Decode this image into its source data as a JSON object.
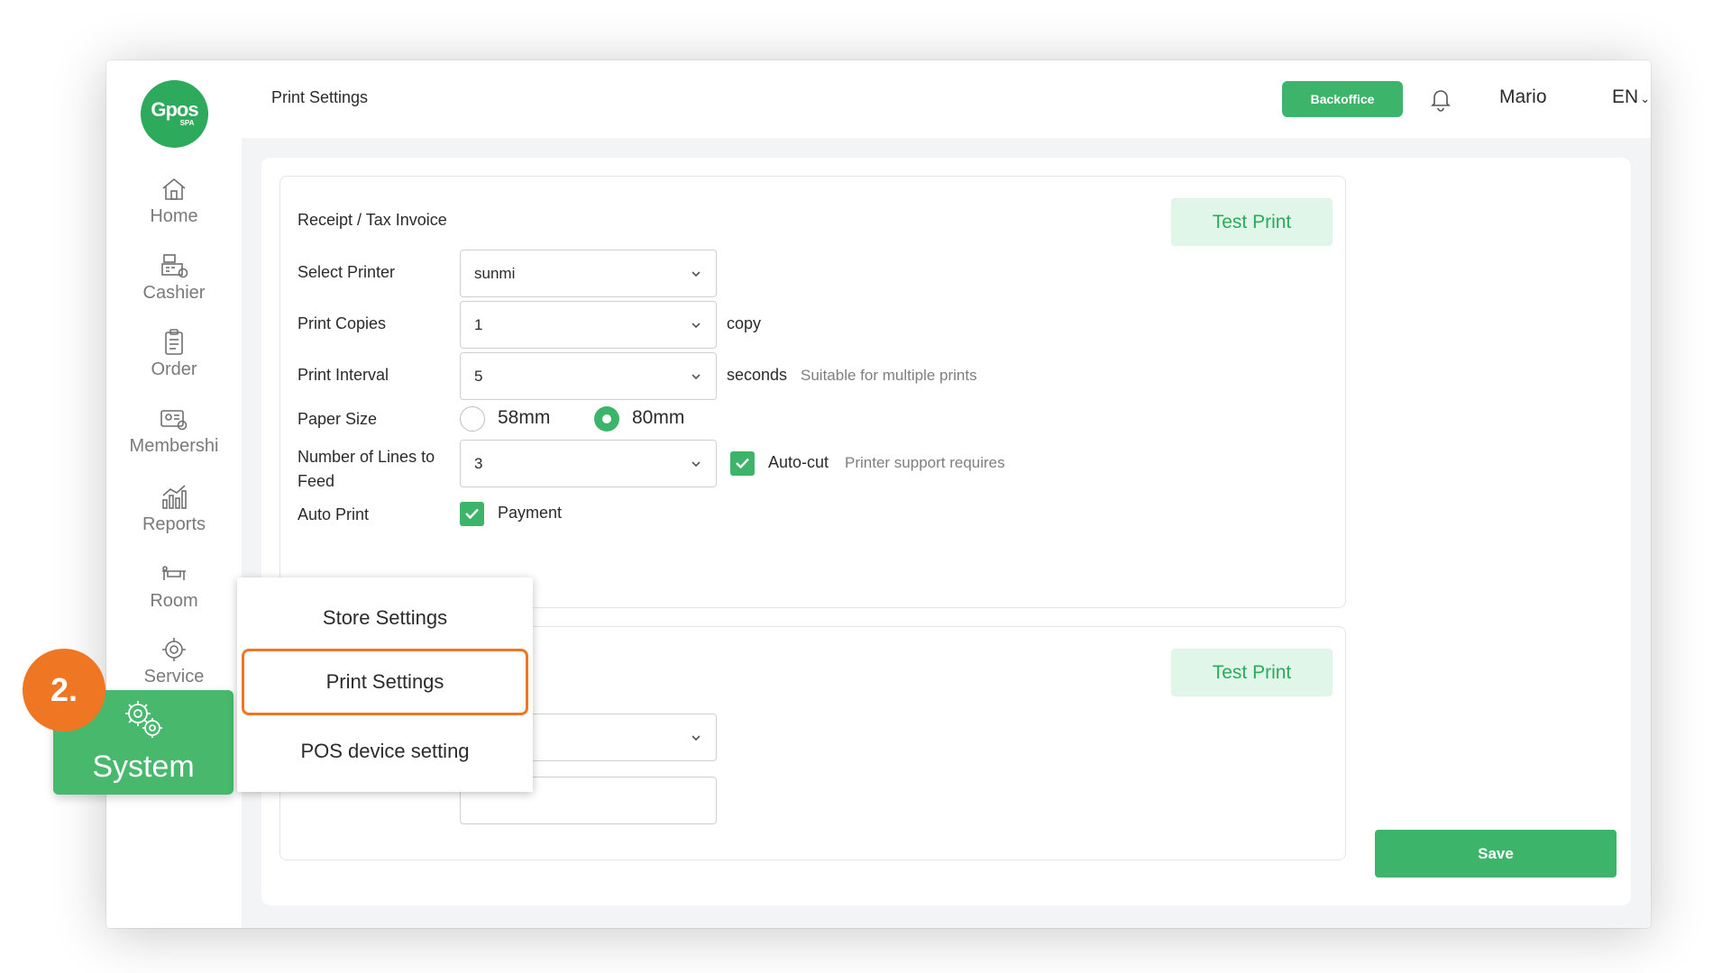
{
  "app": {
    "logo_text": "Gpos",
    "logo_sub": "SPA"
  },
  "sidebar": {
    "items": [
      {
        "label": "Home",
        "icon": "home-icon"
      },
      {
        "label": "Cashier",
        "icon": "cashier-icon"
      },
      {
        "label": "Order",
        "icon": "order-icon"
      },
      {
        "label": "Membershi",
        "icon": "membership-icon"
      },
      {
        "label": "Reports",
        "icon": "reports-icon"
      },
      {
        "label": "Room",
        "icon": "room-icon"
      },
      {
        "label": "Service",
        "icon": "service-icon"
      }
    ],
    "system_label": "System"
  },
  "header": {
    "title": "Print Settings",
    "backoffice_label": "Backoffice",
    "user_name": "Mario",
    "language": "EN"
  },
  "receipt": {
    "title": "Receipt / Tax Invoice",
    "test_print_label": "Test Print",
    "select_printer_label": "Select Printer",
    "select_printer_value": "sunmi",
    "print_copies_label": "Print Copies",
    "print_copies_value": "1",
    "print_copies_suffix": "copy",
    "print_interval_label": "Print Interval",
    "print_interval_value": "5",
    "print_interval_suffix": "seconds",
    "print_interval_hint": "Suitable for multiple prints",
    "paper_size_label": "Paper Size",
    "paper_size_options": [
      "58mm",
      "80mm"
    ],
    "paper_size_selected": "80mm",
    "feed_lines_label": "Number of Lines to Feed",
    "feed_lines_value": "3",
    "auto_cut_label": "Auto-cut",
    "auto_cut_checked": true,
    "auto_cut_hint": "Printer support requires",
    "auto_print_label": "Auto Print",
    "auto_print_option": "Payment"
  },
  "second_section": {
    "test_print_label": "Test Print"
  },
  "footer": {
    "save_label": "Save"
  },
  "system_menu": {
    "items": [
      "Store Settings",
      "Print Settings",
      "POS device setting"
    ],
    "active": "Print Settings"
  },
  "callout": {
    "step": "2."
  },
  "colors": {
    "accent": "#3cb56a",
    "accent_light": "#dff6e8",
    "highlight": "#ef7622"
  }
}
